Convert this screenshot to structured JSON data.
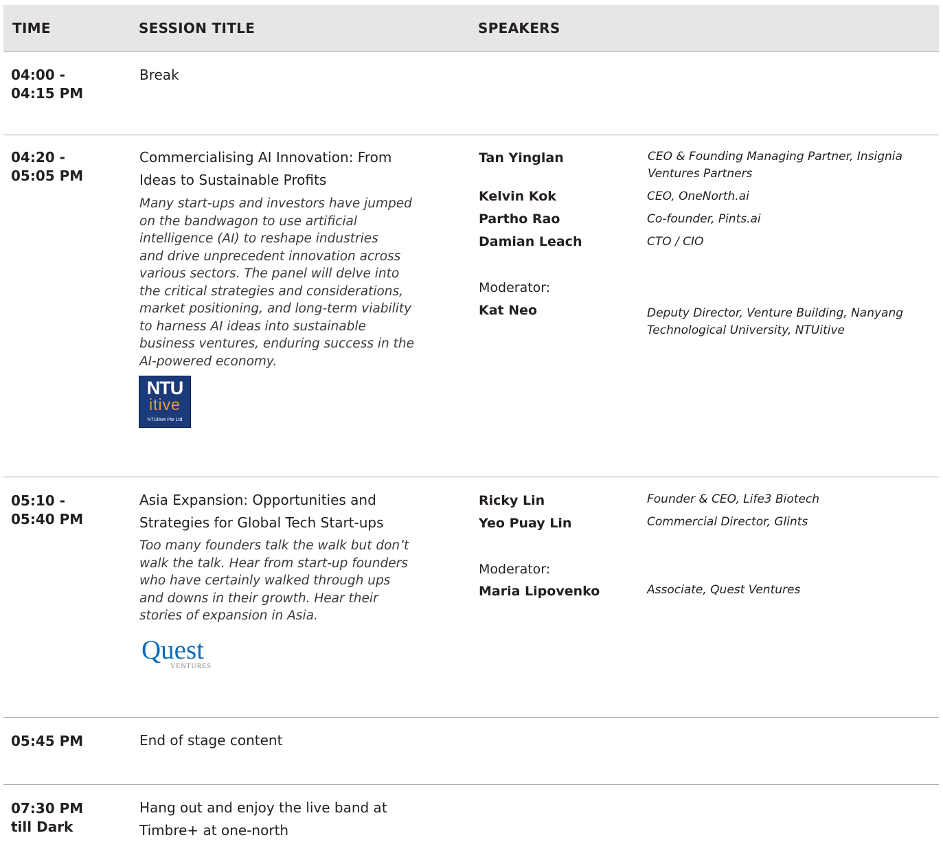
{
  "header": {
    "time": "TIME",
    "session_title": "SESSION TITLE",
    "speakers": "SPEAKERS"
  },
  "sessions": [
    {
      "time_lines": [
        "04:00 -",
        "04:15 PM"
      ],
      "title": "Break"
    },
    {
      "time_lines": [
        "04:20 -",
        "05:05 PM"
      ],
      "title_lines": [
        "Commercialising AI Innovation: From",
        "Ideas to Sustainable Profits"
      ],
      "description_lines": [
        "Many start-ups and investors have jumped",
        "on the bandwagon to use artificial",
        "intelligence (AI) to reshape industries",
        "and drive unprecedent innovation across",
        "various sectors. The panel will delve into",
        "the critical strategies and considerations,",
        "market positioning, and long-term viability",
        "to harness AI ideas into sustainable",
        "business ventures, enduring success in the",
        "AI-powered economy."
      ],
      "logo": {
        "icon": "ntuitive-logo",
        "line1": "NTU",
        "line2": "itive",
        "line3": "NTUitive Pte Ltd"
      },
      "speakers": [
        {
          "name": "Tan Yinglan",
          "role_lines": [
            "CEO & Founding Managing Partner, Insignia",
            "Ventures Partners"
          ]
        },
        {
          "name": "Kelvin Kok",
          "role_lines": [
            "CEO, OneNorth.ai"
          ]
        },
        {
          "name": "Partho Rao",
          "role_lines": [
            "Co-founder, Pints.ai"
          ]
        },
        {
          "name": "Damian Leach",
          "role_lines": [
            "CTO / CIO"
          ]
        }
      ],
      "moderator_label": "Moderator:",
      "moderator": {
        "name": "Kat Neo",
        "role_lines": [
          "Deputy Director, Venture Building, Nanyang",
          "Technological University, NTUitive"
        ]
      }
    },
    {
      "time_lines": [
        "05:10 -",
        "05:40 PM"
      ],
      "title_lines": [
        "Asia Expansion: Opportunities and",
        "Strategies for Global Tech Start-ups"
      ],
      "description_lines": [
        "Too many founders talk the walk but don’t",
        "walk the talk. Hear from start-up founders",
        "who have certainly walked through ups",
        "and downs in their growth. Hear their",
        "stories of expansion in Asia."
      ],
      "logo": {
        "icon": "quest-ventures-logo",
        "line1": "Quest",
        "line2": "VENTURES"
      },
      "speakers": [
        {
          "name": "Ricky Lin",
          "role_lines": [
            "Founder & CEO, Life3 Biotech"
          ]
        },
        {
          "name": "Yeo Puay Lin",
          "role_lines": [
            "Commercial Director, Glints"
          ]
        }
      ],
      "moderator_label": "Moderator:",
      "moderator": {
        "name": "Maria Lipovenko",
        "role_lines": [
          "Associate, Quest Ventures"
        ]
      }
    },
    {
      "time_lines": [
        "05:45 PM"
      ],
      "title": "End of stage content"
    },
    {
      "time_lines": [
        "07:30 PM",
        "till Dark"
      ],
      "title_lines": [
        "Hang out and enjoy the live band at",
        "Timbre+ at one-north"
      ]
    }
  ]
}
